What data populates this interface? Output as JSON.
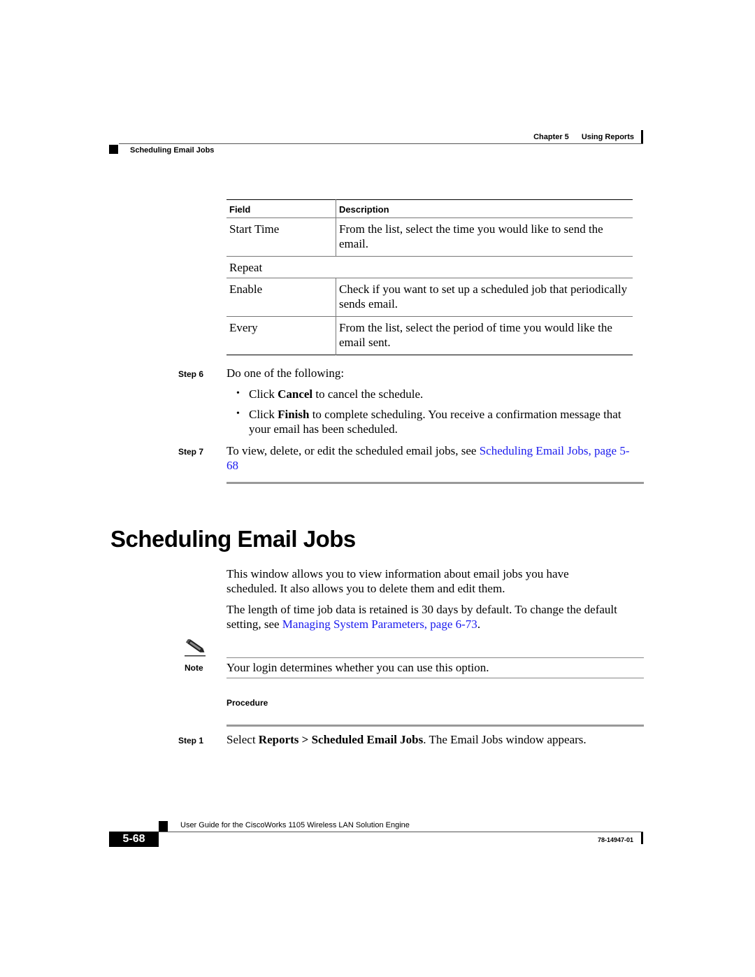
{
  "header": {
    "chapter": "Chapter 5",
    "chapter_title": "Using Reports",
    "section": "Scheduling Email Jobs"
  },
  "table": {
    "columns": [
      "Field",
      "Description"
    ],
    "rows": [
      {
        "field": "Start Time",
        "description": "From the list, select the time you would like to send the email."
      },
      {
        "field": "Repeat",
        "description": ""
      },
      {
        "field": "Enable",
        "description": "Check if you want to set up a scheduled job that periodically sends email."
      },
      {
        "field": "Every",
        "description": "From the list, select the period of time you would like the email sent."
      }
    ]
  },
  "steps_before": [
    {
      "label": "Step 6",
      "text": "Do one of the following:",
      "bullets": [
        {
          "pre": "Click ",
          "bold": "Cancel",
          "post": " to cancel the schedule."
        },
        {
          "pre": "Click ",
          "bold": "Finish",
          "post": " to complete scheduling. You receive a confirmation message that your email has been scheduled."
        }
      ]
    },
    {
      "label": "Step 7",
      "pre": "To view, delete, or edit the scheduled email jobs, see ",
      "link": "Scheduling Email Jobs, page 5-68"
    }
  ],
  "section": {
    "title": "Scheduling Email Jobs",
    "para1": "This window allows you to view information about email jobs you have scheduled. It also allows you to delete them and edit them.",
    "para2_pre": "The length of time job data is retained is 30 days by default. To change the default setting, see ",
    "para2_link": "Managing System Parameters, page 6-73",
    "para2_post": "."
  },
  "note": {
    "label": "Note",
    "text": "Your login determines whether you can use this option."
  },
  "procedure": {
    "label": "Procedure",
    "steps": [
      {
        "label": "Step 1",
        "pre": "Select ",
        "bold1": "Reports",
        "mid": " > ",
        "bold2": "Scheduled Email Jobs",
        "post": ". The Email Jobs window appears."
      }
    ]
  },
  "footer": {
    "title": "User Guide for the CiscoWorks 1105 Wireless LAN Solution Engine",
    "page": "5-68",
    "doc_number": "78-14947-01"
  },
  "colors": {
    "link": "#1a1aee",
    "rule": "#999999"
  }
}
